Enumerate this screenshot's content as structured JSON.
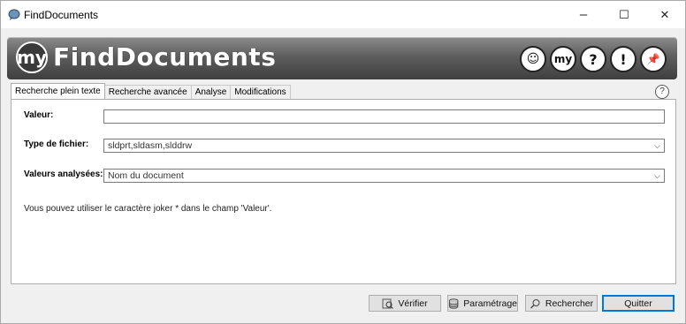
{
  "window": {
    "title": "FindDocuments",
    "minimize": "–",
    "maximize": "☐",
    "close": "✕"
  },
  "banner": {
    "logo_mark": "my",
    "app_name": "FindDocuments",
    "icons": [
      {
        "name": "stars-face-icon",
        "glyph": "☺"
      },
      {
        "name": "my-logo-icon",
        "glyph": "my"
      },
      {
        "name": "question-icon",
        "glyph": "?"
      },
      {
        "name": "exclamation-icon",
        "glyph": "!"
      },
      {
        "name": "pushpin-icon",
        "glyph": "📌"
      }
    ]
  },
  "tabs": [
    "Recherche plein texte",
    "Recherche avancée",
    "Analyse",
    "Modifications"
  ],
  "help_glyph": "?",
  "form": {
    "valeur_label": "Valeur:",
    "valeur_value": "",
    "type_label": "Type de fichier:",
    "type_value": "sldprt,sldasm,slddrw",
    "analysed_label": "Valeurs analysées:",
    "analysed_value": "Nom du document",
    "hint": "Vous pouvez utiliser le caractère joker * dans le champ 'Valeur'."
  },
  "buttons": {
    "verify": "Vérifier",
    "settings": "Paramétrage",
    "search": "Rechercher",
    "quit": "Quitter"
  }
}
